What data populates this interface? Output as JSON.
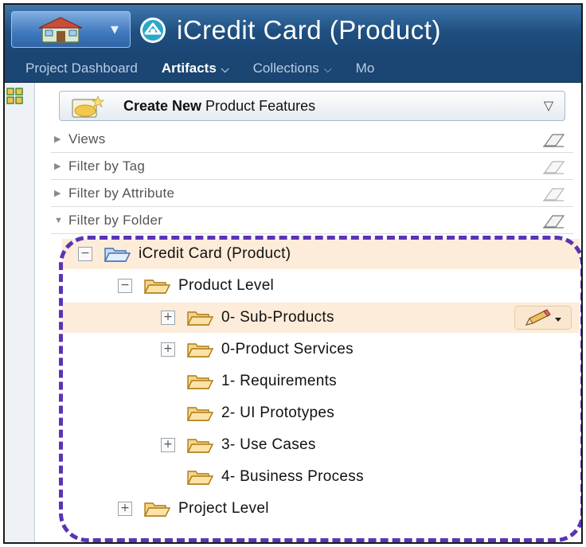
{
  "header": {
    "title": "iCredit Card (Product)",
    "home_icon": "home-icon",
    "home_dropdown_icon": "chevron-down-icon",
    "project_icon": "project-logo-icon"
  },
  "nav": {
    "items": [
      {
        "label": "Project Dashboard",
        "has_menu": false
      },
      {
        "label": "Artifacts",
        "has_menu": true,
        "active": true
      },
      {
        "label": "Collections",
        "has_menu": true
      },
      {
        "label": "Mo",
        "has_menu": false
      }
    ]
  },
  "sidebar": {
    "create_button": {
      "bold": "Create New",
      "rest": " Product Features"
    },
    "filters": [
      {
        "label": "Views",
        "expanded": false
      },
      {
        "label": "Filter by Tag",
        "expanded": false
      },
      {
        "label": "Filter by Attribute",
        "expanded": false
      },
      {
        "label": "Filter by Folder",
        "expanded": true
      }
    ]
  },
  "tree": {
    "root": "iCredit Card (Product)",
    "product_level": "Product Level",
    "children": [
      {
        "label": "0- Sub-Products",
        "expandable": true,
        "selected": true
      },
      {
        "label": "0-Product Services",
        "expandable": true
      },
      {
        "label": "1- Requirements",
        "expandable": false
      },
      {
        "label": "2- UI Prototypes",
        "expandable": false
      },
      {
        "label": "3- Use Cases",
        "expandable": true
      },
      {
        "label": "4- Business Process",
        "expandable": false
      }
    ],
    "project_level": "Project Level",
    "expander_collapsed": "+",
    "expander_expanded": "−"
  },
  "colors": {
    "titlebar": "#1f4f80",
    "navbar": "#1b4572",
    "selected_row": "#fcecd9",
    "dashed_outline": "#5a34b5",
    "folder": "#f0b84a"
  }
}
